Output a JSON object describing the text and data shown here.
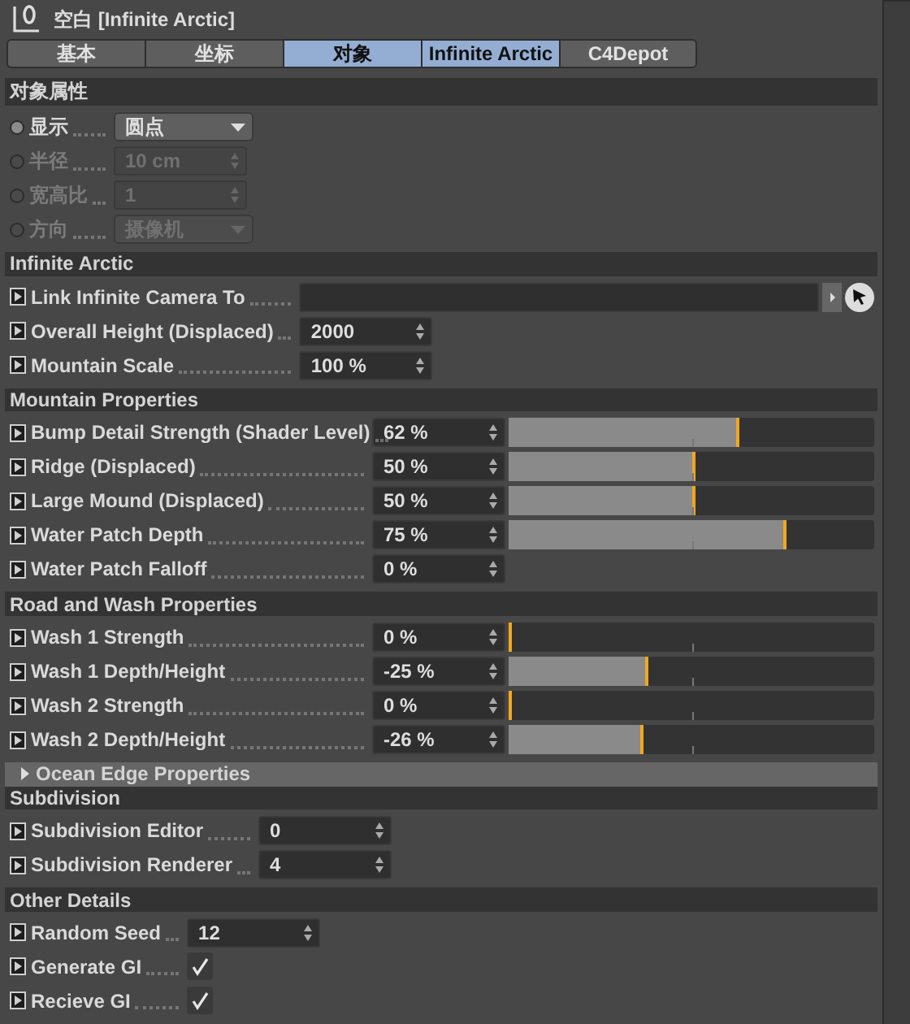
{
  "window": {
    "title": "空白 [Infinite Arctic]"
  },
  "tabs": [
    {
      "label": "基本",
      "selected": false
    },
    {
      "label": "坐标",
      "selected": false
    },
    {
      "label": "对象",
      "selected": true
    },
    {
      "label": "Infinite Arctic",
      "selected": true
    },
    {
      "label": "C4Depot",
      "selected": false
    }
  ],
  "sections": [
    {
      "kind": "header",
      "title": "对象属性",
      "rows": [
        {
          "kind": "dropdown",
          "label": "显示",
          "value": "圆点",
          "disabled": false
        },
        {
          "kind": "number",
          "label": "半径",
          "value": "10 cm",
          "disabled": true
        },
        {
          "kind": "number",
          "label": "宽高比",
          "value": "1",
          "disabled": true
        },
        {
          "kind": "dropdown",
          "label": "方向",
          "value": "摄像机",
          "disabled": true
        }
      ]
    },
    {
      "kind": "header",
      "title": "Infinite Arctic",
      "rows": [
        {
          "kind": "link",
          "label": "Link Infinite Camera To"
        },
        {
          "kind": "number",
          "label": "Overall Height (Displaced)",
          "value": "2000"
        },
        {
          "kind": "number",
          "label": "Mountain Scale",
          "value": "100 %"
        }
      ]
    },
    {
      "kind": "header",
      "title": "Mountain Properties",
      "rows": [
        {
          "kind": "slider",
          "label": "Bump Detail Strength (Shader Level)",
          "value": "62 %",
          "level": 0.63
        },
        {
          "kind": "slider",
          "label": "Ridge (Displaced)",
          "value": "50 %",
          "level": 0.51
        },
        {
          "kind": "slider",
          "label": "Large Mound (Displaced)",
          "value": "50 %",
          "level": 0.51
        },
        {
          "kind": "slider",
          "label": "Water Patch Depth",
          "value": "75 %",
          "level": 0.76
        },
        {
          "kind": "number",
          "label": "Water Patch Falloff",
          "value": "0 %"
        }
      ]
    },
    {
      "kind": "header",
      "title": "Road and Wash Properties",
      "rows": [
        {
          "kind": "slider",
          "label": "Wash 1 Strength",
          "value": "0 %",
          "level": 0
        },
        {
          "kind": "slider",
          "label": "Wash 1 Depth/Height",
          "value": "-25 %",
          "level": 0.38
        },
        {
          "kind": "slider",
          "label": "Wash 2 Strength",
          "value": "0 %",
          "level": 0
        },
        {
          "kind": "slider",
          "label": "Wash 2 Depth/Height",
          "value": "-26 %",
          "level": 0.37
        }
      ]
    },
    {
      "kind": "foldout",
      "title": "Ocean Edge Properties",
      "expanded": false
    },
    {
      "kind": "header",
      "title": "Subdivision",
      "rows": [
        {
          "kind": "number",
          "label": "Subdivision Editor",
          "value": "0"
        },
        {
          "kind": "number",
          "label": "Subdivision Renderer",
          "value": "4"
        }
      ]
    },
    {
      "kind": "header",
      "title": "Other Details",
      "rows": [
        {
          "kind": "number",
          "label": "Random Seed",
          "value": "12"
        },
        {
          "kind": "checkbox",
          "label": "Generate GI",
          "checked": true
        },
        {
          "kind": "checkbox",
          "label": "Recieve GI",
          "checked": true
        }
      ]
    }
  ]
}
